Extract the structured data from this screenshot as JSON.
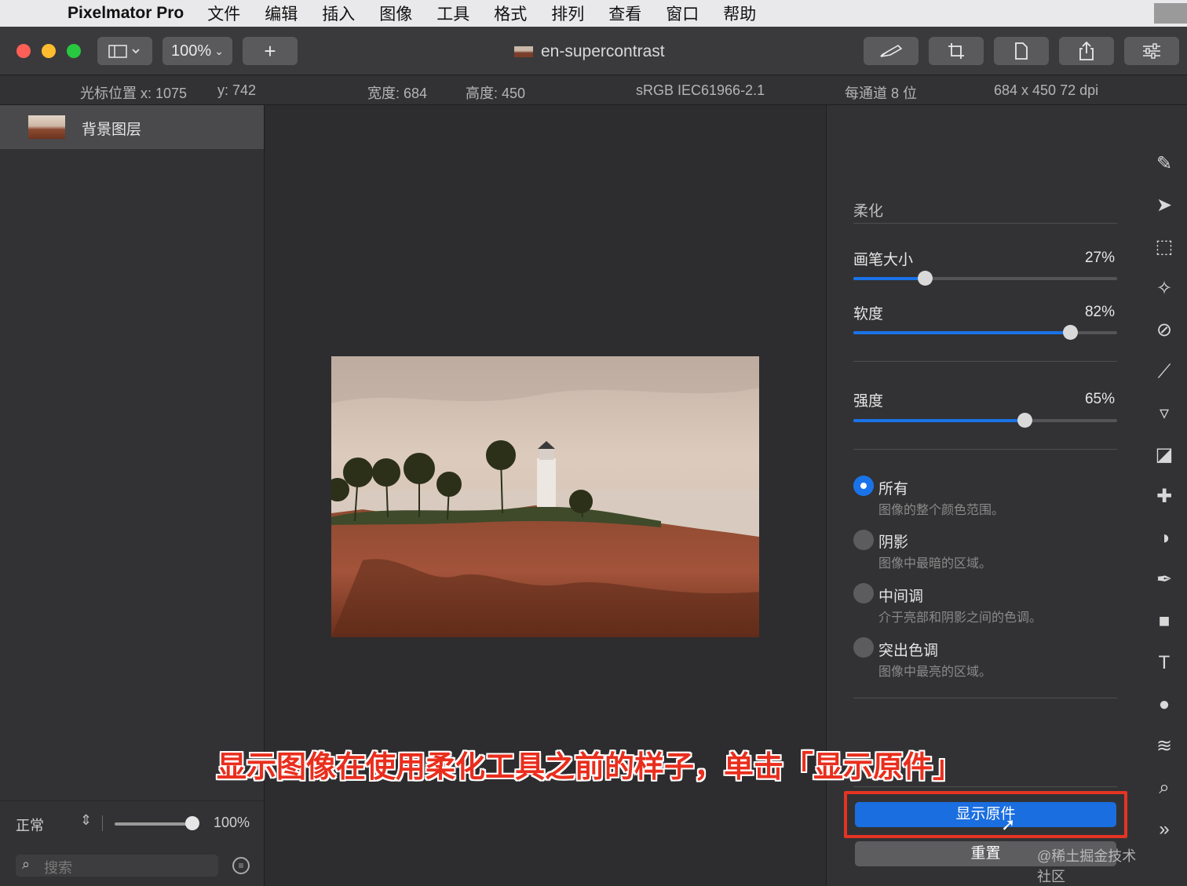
{
  "menubar": {
    "app_name": "Pixelmator Pro",
    "items": [
      "文件",
      "编辑",
      "插入",
      "图像",
      "工具",
      "格式",
      "排列",
      "查看",
      "窗口",
      "帮助"
    ]
  },
  "toolbar": {
    "zoom": "100%",
    "add_label": "+",
    "document_title": "en-supercontrast"
  },
  "infobar": {
    "cursor_label": "光标位置 x: 1075",
    "cursor_y": "y: 742",
    "width": "宽度: 684",
    "height": "高度: 450",
    "color_profile": "sRGB IEC61966-2.1",
    "bit_depth": "每通道 8 位",
    "dimensions": "684 x 450 72 dpi"
  },
  "layers": {
    "items": [
      {
        "name": "背景图层"
      }
    ],
    "blend_mode": "正常",
    "opacity": "100%",
    "opacity_fraction": 1.0,
    "search_placeholder": "搜索"
  },
  "soften": {
    "section_title": "柔化",
    "sliders": [
      {
        "label": "画笔大小",
        "value": "27%",
        "fraction": 0.27
      },
      {
        "label": "软度",
        "value": "82%",
        "fraction": 0.82
      },
      {
        "label": "强度",
        "value": "65%",
        "fraction": 0.65
      }
    ],
    "ranges": [
      {
        "title": "所有",
        "desc": "图像的整个颜色范围。",
        "selected": true
      },
      {
        "title": "阴影",
        "desc": "图像中最暗的区域。",
        "selected": false
      },
      {
        "title": "中间调",
        "desc": "介于亮部和阴影之间的色调。",
        "selected": false
      },
      {
        "title": "突出色调",
        "desc": "图像中最亮的区域。",
        "selected": false
      }
    ],
    "show_original_label": "显示原件",
    "reset_label": "重置"
  },
  "caption": "显示图像在使用柔化工具之前的样子，单击「显示原件」",
  "watermark": "@稀土掘金技术社区",
  "colors": {
    "accent": "#1a73e8",
    "annotation_red": "#e53323"
  }
}
